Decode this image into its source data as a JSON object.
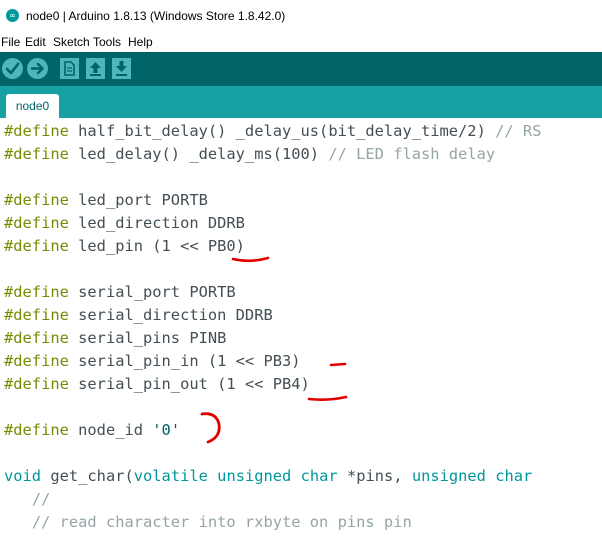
{
  "window": {
    "title": "node0 | Arduino 1.8.13 (Windows Store 1.8.42.0)"
  },
  "menu": [
    "File",
    "Edit",
    "Sketch",
    "Tools",
    "Help"
  ],
  "toolbar": {
    "icons": [
      "verify-icon",
      "upload-icon",
      "new-icon",
      "open-icon",
      "save-icon"
    ]
  },
  "tabs": [
    {
      "label": "node0"
    }
  ],
  "colors": {
    "toolbar": "#006468",
    "tabbar": "#17a1a5",
    "button": "#4db7bb",
    "keyword": "#728e00",
    "type": "#00979c",
    "comment": "#95a5a6",
    "annotation": "#e00000"
  },
  "code": {
    "lines": [
      [
        {
          "t": "#define",
          "c": "kw"
        },
        {
          "t": " half_bit_delay() _delay_us(bit_delay_time/2) "
        },
        {
          "t": "// RS",
          "c": "cm"
        }
      ],
      [
        {
          "t": "#define",
          "c": "kw"
        },
        {
          "t": " led_delay() _delay_ms(100) "
        },
        {
          "t": "// LED flash delay",
          "c": "cm"
        }
      ],
      [],
      [
        {
          "t": "#define",
          "c": "kw"
        },
        {
          "t": " led_port PORTB"
        }
      ],
      [
        {
          "t": "#define",
          "c": "kw"
        },
        {
          "t": " led_direction DDRB"
        }
      ],
      [
        {
          "t": "#define",
          "c": "kw"
        },
        {
          "t": " led_pin (1 << PB0)"
        }
      ],
      [],
      [
        {
          "t": "#define",
          "c": "kw"
        },
        {
          "t": " serial_port PORTB"
        }
      ],
      [
        {
          "t": "#define",
          "c": "kw"
        },
        {
          "t": " serial_direction DDRB"
        }
      ],
      [
        {
          "t": "#define",
          "c": "kw"
        },
        {
          "t": " serial_pins PINB"
        }
      ],
      [
        {
          "t": "#define",
          "c": "kw"
        },
        {
          "t": " serial_pin_in (1 << PB3)"
        }
      ],
      [
        {
          "t": "#define",
          "c": "kw"
        },
        {
          "t": " serial_pin_out (1 << PB4)"
        }
      ],
      [],
      [
        {
          "t": "#define",
          "c": "kw"
        },
        {
          "t": " node_id "
        },
        {
          "t": "'0'",
          "c": "st"
        }
      ],
      [],
      [
        {
          "t": "void",
          "c": "ty"
        },
        {
          "t": " get_char("
        },
        {
          "t": "volatile",
          "c": "ty"
        },
        {
          "t": " "
        },
        {
          "t": "unsigned",
          "c": "ty"
        },
        {
          "t": " "
        },
        {
          "t": "char",
          "c": "ty"
        },
        {
          "t": " *pins, "
        },
        {
          "t": "unsigned",
          "c": "ty"
        },
        {
          "t": " "
        },
        {
          "t": "char",
          "c": "ty"
        },
        {
          "t": " "
        }
      ],
      [
        {
          "t": "   "
        },
        {
          "t": "//",
          "c": "cm"
        }
      ],
      [
        {
          "t": "   "
        },
        {
          "t": "// read character into rxbyte on pins pin",
          "c": "cm"
        }
      ]
    ]
  }
}
